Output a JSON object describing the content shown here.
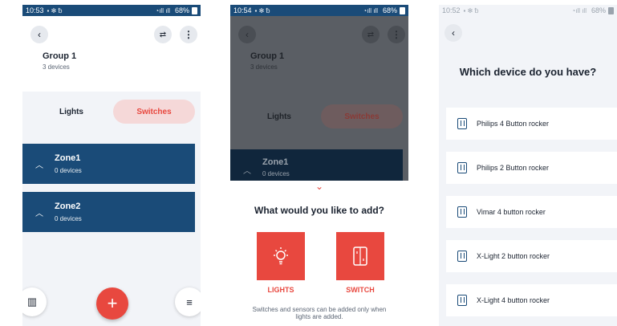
{
  "screen1": {
    "status": {
      "time": "10:53",
      "battery": "68%"
    },
    "group": {
      "title": "Group 1",
      "subtitle": "3 devices"
    },
    "tabs": {
      "lights": "Lights",
      "switches": "Switches"
    },
    "zones": [
      {
        "name": "Zone1",
        "count": "0 devices"
      },
      {
        "name": "Zone2",
        "count": "0 devices"
      }
    ],
    "fab": "+"
  },
  "screen2": {
    "status": {
      "time": "10:54",
      "battery": "68%"
    },
    "group": {
      "title": "Group 1",
      "subtitle": "3 devices"
    },
    "tabs": {
      "lights": "Lights",
      "switches": "Switches"
    },
    "zone": {
      "name": "Zone1",
      "count": "0 devices"
    },
    "sheet": {
      "title": "What would you like to add?",
      "lights_label": "LIGHTS",
      "switch_label": "SWITCH",
      "note": "Switches and sensors can be added only when lights are added."
    }
  },
  "screen3": {
    "status": {
      "time": "10:52",
      "battery": "68%"
    },
    "title": "Which device do you have?",
    "devices": [
      "Philips 4 Button rocker",
      "Philips 2 Button rocker",
      "Vimar 4 button rocker",
      "X-Light 2 button rocker",
      "X-Light 4 button rocker"
    ]
  },
  "colors": {
    "accent": "#e8483f",
    "navy": "#1a4b78",
    "pink": "#f5d8d8"
  }
}
